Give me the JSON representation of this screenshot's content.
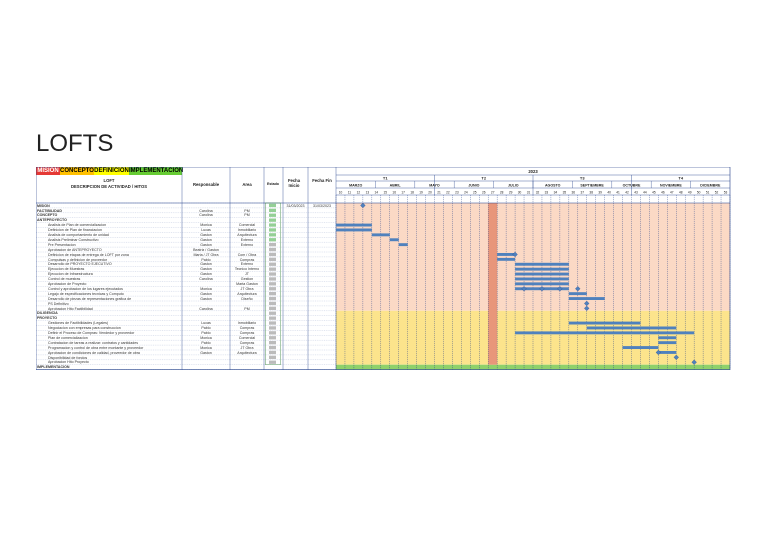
{
  "title": "LOFTS",
  "legend": {
    "mision": "MISION",
    "concepto": "CONCEPTO",
    "definicion": "DEFINICION",
    "implementacion": "IMPLEMENTACION"
  },
  "colors": {
    "mision": "#e53935",
    "concepto": "#ffc000",
    "definicion": "#ffff00",
    "implementacion": "#66cc33",
    "concept_band": "#fbd9c5",
    "def_band": "#fce48c",
    "impl_band": "#8fd16a",
    "week_col": "#e8967a",
    "bar": "#4f81bd",
    "grid": "#1f3c88"
  },
  "headers": {
    "loft": "LOFT",
    "descripcion": "DESCRIPCION DE ACTIVIDAD / HITOS",
    "responsable": "Responsable",
    "area": "Area",
    "estado": "Estado",
    "fecha_inicio": "Fecha Inicio",
    "fecha_fin": "Fecha Fin",
    "year": "2023",
    "quarters": [
      "T1",
      "T2",
      "T3",
      "T4"
    ],
    "months": [
      "MARZO",
      "ABRIL",
      "MAYO",
      "JUNIO",
      "JULIO",
      "AGOSTO",
      "SEPTIEMBRE",
      "OCTUBRE",
      "NOVIEMBRE",
      "DICIEMBRE"
    ]
  },
  "rows": [
    {
      "desc": "MISION",
      "resp": "",
      "area": "",
      "ini": "31/03/2023",
      "fin": "31/03/2023"
    },
    {
      "desc": "FACTIBILIDAD",
      "resp": "Carolina",
      "area": "PM",
      "ini": "",
      "fin": ""
    },
    {
      "desc": "CONCEPTO",
      "resp": "Carolina",
      "area": "PM",
      "ini": "",
      "fin": ""
    },
    {
      "desc": "ANTEPROYECTO",
      "resp": "",
      "area": "",
      "ini": "",
      "fin": ""
    },
    {
      "desc": "Analisis de Plan de comercializacion",
      "resp": "Monica",
      "area": "Comercial",
      "ini": "",
      "fin": ""
    },
    {
      "desc": "Definicion de Plan de financiacion",
      "resp": "Lucas",
      "area": "Inmobiliario",
      "ini": "",
      "fin": ""
    },
    {
      "desc": "Analisis de comportamiento de unidad",
      "resp": "Gaston",
      "area": "Arquitectura",
      "ini": "",
      "fin": ""
    },
    {
      "desc": "Analisis Preliminar Constructivo",
      "resp": "Gaston",
      "area": "Externo",
      "ini": "",
      "fin": ""
    },
    {
      "desc": "Pre Presentacion",
      "resp": "Gaston",
      "area": "Externo",
      "ini": "",
      "fin": ""
    },
    {
      "desc": "Aprobacion de ANTEPROYECTO",
      "resp": "Beatriz / Gaston",
      "area": "",
      "ini": "",
      "fin": ""
    },
    {
      "desc": "Definicion de etapas de entrega de LOFT por zona",
      "resp": "Marta / JT Obra",
      "area": "Com / Obra",
      "ini": "",
      "fin": ""
    },
    {
      "desc": "Compulsas y definicion de proveedor",
      "resp": "Pablo",
      "area": "Compras",
      "ini": "",
      "fin": ""
    },
    {
      "desc": "Desarrollo de PROYECTO EJECUTIVO",
      "resp": "Gaston",
      "area": "Externo",
      "ini": "",
      "fin": ""
    },
    {
      "desc": "Ejecucion de Muestras",
      "resp": "Gaston",
      "area": "Tecnico Interno",
      "ini": "",
      "fin": ""
    },
    {
      "desc": "Ejecucion de Infraestructura",
      "resp": "Gaston",
      "area": "JT",
      "ini": "",
      "fin": ""
    },
    {
      "desc": "Control de muestras",
      "resp": "Carolina",
      "area": "Gestion",
      "ini": "",
      "fin": ""
    },
    {
      "desc": "Aprobacion de Proyecto",
      "resp": "",
      "area": "Marta Gaston",
      "ini": "",
      "fin": ""
    },
    {
      "desc": "Control y aprobacion de los lugares ejecutados",
      "resp": "Monica",
      "area": "JT Obra",
      "ini": "",
      "fin": ""
    },
    {
      "desc": "Legajo de especificaciones tecnicas y Computo",
      "resp": "Gaston",
      "area": "Arquitectura",
      "ini": "",
      "fin": ""
    },
    {
      "desc": "Desarrollo de piezas de representaciones grafica de",
      "resp": "Gaston",
      "area": "Diseño",
      "ini": "",
      "fin": ""
    },
    {
      "desc": "PS Definitivo",
      "resp": "",
      "area": "",
      "ini": "",
      "fin": ""
    },
    {
      "desc": "Aprobacion Hito Factibilidad",
      "resp": "Carolina",
      "area": "PM",
      "ini": "",
      "fin": ""
    },
    {
      "desc": "DILIGENCIA",
      "resp": "",
      "area": "",
      "ini": "",
      "fin": ""
    },
    {
      "desc": "PROYECTO",
      "resp": "",
      "area": "",
      "ini": "",
      "fin": ""
    },
    {
      "desc": "Gestiones de Factibilidades (Legales)",
      "resp": "Lucas",
      "area": "Inmobiliario",
      "ini": "",
      "fin": ""
    },
    {
      "desc": "Negociacion con empresas para construccion",
      "resp": "Pablo",
      "area": "Compras",
      "ini": "",
      "fin": ""
    },
    {
      "desc": "Definir el Proceso de Compras: Vendedor y proveedor",
      "resp": "Pablo",
      "area": "Compras",
      "ini": "",
      "fin": ""
    },
    {
      "desc": "Plan de comercializacion",
      "resp": "Monica",
      "area": "Comercial",
      "ini": "",
      "fin": ""
    },
    {
      "desc": "Contratacion de tareas a realizar: contratos y cantidades",
      "resp": "Pablo",
      "area": "Compras",
      "ini": "",
      "fin": ""
    },
    {
      "desc": "Programacion y control de obra entre montante y proveedor",
      "resp": "Monica",
      "area": "JT Obra",
      "ini": "",
      "fin": ""
    },
    {
      "desc": "Aprobacion de condiciones de calidad, proveedor de obra",
      "resp": "Gaston",
      "area": "Arquitectura",
      "ini": "",
      "fin": ""
    },
    {
      "desc": "Disponibilidad de fondos",
      "resp": "",
      "area": "",
      "ini": "",
      "fin": ""
    },
    {
      "desc": "Aprobacion Hito Proyecto",
      "resp": "",
      "area": "",
      "ini": "",
      "fin": ""
    },
    {
      "desc": "IMPLEMENTACION",
      "resp": "",
      "area": "",
      "ini": "",
      "fin": ""
    }
  ]
}
